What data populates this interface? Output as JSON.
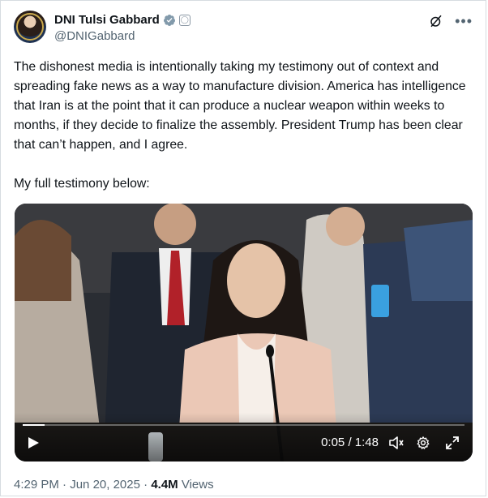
{
  "author": {
    "display_name": "DNI Tulsi Gabbard",
    "handle": "@DNIGabbard",
    "verified_color": "#829aab"
  },
  "tweet": {
    "paragraphs": [
      "The dishonest media is intentionally taking my testimony out of context and spreading fake news as a way to manufacture division. America has intelligence that Iran is at the point that it can produce a nuclear weapon within weeks to months, if they decide to finalize the assembly. President Trump has been clear that can’t happen, and I agree.",
      "My full testimony below:"
    ]
  },
  "video": {
    "elapsed": "0:05",
    "separator": " / ",
    "duration": "1:48",
    "progress_fraction": 0.05
  },
  "meta": {
    "time": "4:29 PM",
    "dot": " · ",
    "date": "Jun 20, 2025",
    "views_count": "4.4M",
    "views_label": " Views"
  },
  "icons": {
    "verified": "verified-badge-icon",
    "gov": "government-affiliation-icon",
    "grok": "grok-icon",
    "more": "more-icon",
    "play": "play-icon",
    "volume": "volume-icon",
    "settings": "gear-icon",
    "expand": "expand-icon"
  }
}
